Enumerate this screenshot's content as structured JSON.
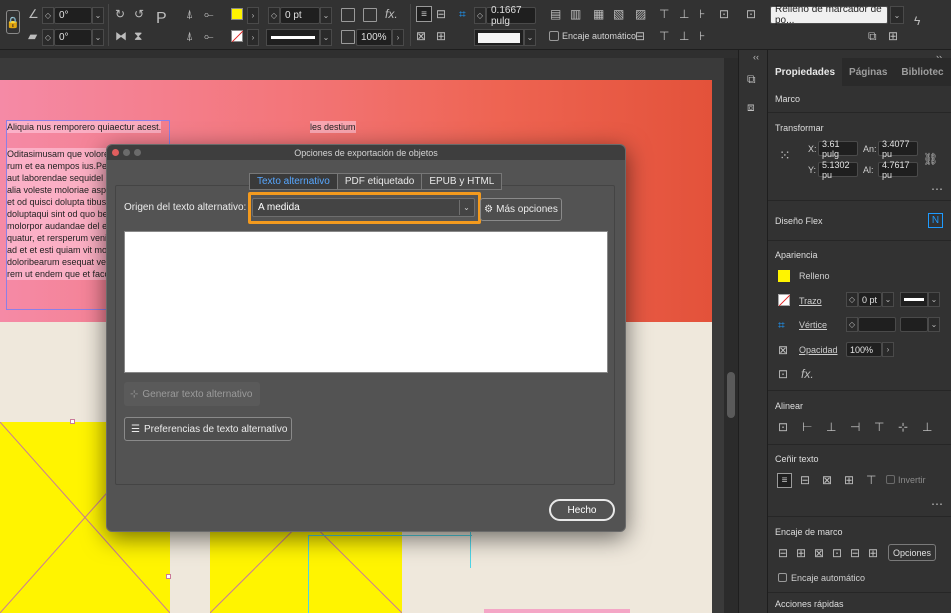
{
  "control_bar": {
    "rotate_angle": "0°",
    "shear_angle": "0°",
    "stroke_weight": "0 pt",
    "scale_percent": "100%",
    "opacity_percent": "100%",
    "offset_value": "0.1667 pulg",
    "object_style": "Relleno de marcador de po...",
    "auto_fit_label": "Encaje automático",
    "fill_color": "#fff400",
    "accent_color": "#1e9bff"
  },
  "document": {
    "line1": "Aliquia nus remporero quiaectur acest.",
    "line2": "les destium",
    "body_lines": [
      "Oditasimusam que volore ve",
      "rum et ea nempos ius.Pero v",
      "aut laborendae sequidel ma",
      "alia voleste moloriae aspe",
      "et od quisci dolupta tibus, c",
      "doluptaqui sint od quo ber",
      "molorpor audandae del es",
      "quatur, et rersperum venis",
      "ad et et esti quiam vit molor",
      "doloribearum esequat velibu",
      "rem ut endem que et facc"
    ]
  },
  "panel": {
    "tabs": [
      "Propiedades",
      "Páginas",
      "Bibliotec"
    ],
    "sections": {
      "frame": "Marco",
      "transform": "Transformar",
      "flex": "Diseño Flex",
      "appearance": "Apariencia",
      "align": "Alinear",
      "wrap": "Ceñir texto",
      "frame_fit": "Encaje de marco",
      "quick_actions": "Acciones rápidas"
    },
    "transform": {
      "x_label": "X:",
      "x_value": "3.61 pulg",
      "y_label": "Y:",
      "y_value": "5.1302 pu",
      "w_label": "An:",
      "w_value": "3.4077 pu",
      "h_label": "Al:",
      "h_value": "4.7617 pu"
    },
    "appearance": {
      "fill_label": "Relleno",
      "stroke_label": "Trazo",
      "stroke_value": "0 pt",
      "corner_label": "Vértice",
      "opacity_label": "Opacidad",
      "opacity_value": "100%"
    },
    "wrap_invert": "Invertir",
    "fit_options_button": "Opciones",
    "auto_fit_label": "Encaje automático"
  },
  "dialog": {
    "title": "Opciones de exportación de objetos",
    "tabs": [
      "Texto alternativo",
      "PDF etiquetado",
      "EPUB y HTML"
    ],
    "source_label": "Origen del texto alternativo:",
    "source_value": "A medida",
    "more_options": "Más opciones",
    "generate_button": "Generar texto alternativo",
    "preferences_button": "Preferencias de texto alternativo",
    "done_button": "Hecho",
    "highlight_color": "#f39a1e"
  }
}
